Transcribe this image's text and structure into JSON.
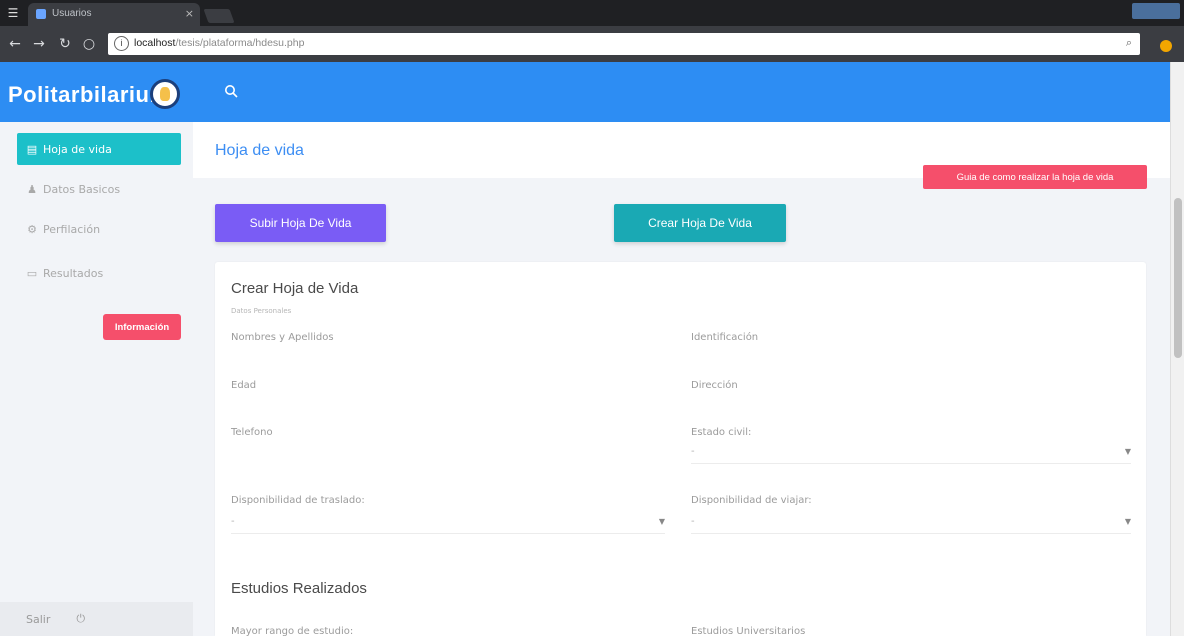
{
  "browser": {
    "tab_title": "Usuarios",
    "url_host": "localhost",
    "url_path": "/tesis/plataforma/hdesu.php",
    "info_glyph": "i"
  },
  "header": {
    "logo_text": "Politarbilarium"
  },
  "sidebar": {
    "items": [
      {
        "label": "Hoja de vida",
        "icon": "id-card-icon"
      },
      {
        "label": "Datos Basicos",
        "icon": "user-icon"
      },
      {
        "label": "Perfilación",
        "icon": "gear-icon"
      },
      {
        "label": "Resultados",
        "icon": "monitor-icon"
      }
    ],
    "info_button": "Información",
    "logout_label": "Salir"
  },
  "page": {
    "title": "Hoja de vida",
    "guide_button": "Guia de como realizar la hoja de vida",
    "upload_button": "Subir Hoja De Vida",
    "create_button": "Crear Hoja De Vida"
  },
  "form": {
    "title": "Crear Hoja de Vida",
    "subtitle": "Datos Personales",
    "fields": {
      "nombres": "Nombres y Apellidos",
      "identificacion": "Identificación",
      "edad": "Edad",
      "direccion": "Dirección",
      "telefono": "Telefono",
      "estado_civil": "Estado civil:",
      "estado_civil_value": "-",
      "traslado": "Disponibilidad de traslado:",
      "traslado_value": "-",
      "viajar": "Disponibilidad de viajar:",
      "viajar_value": "-",
      "mayor_rango": "Mayor rango de estudio:",
      "universitarios": "Estudios Universitarios"
    },
    "section_studies": "Estudios Realizados"
  },
  "colors": {
    "header_blue": "#2d8df3",
    "active_teal": "#1cc0c9",
    "danger_pink": "#f54f6b",
    "upload_purple": "#7a5cf5",
    "create_teal": "#1aa9b4"
  }
}
